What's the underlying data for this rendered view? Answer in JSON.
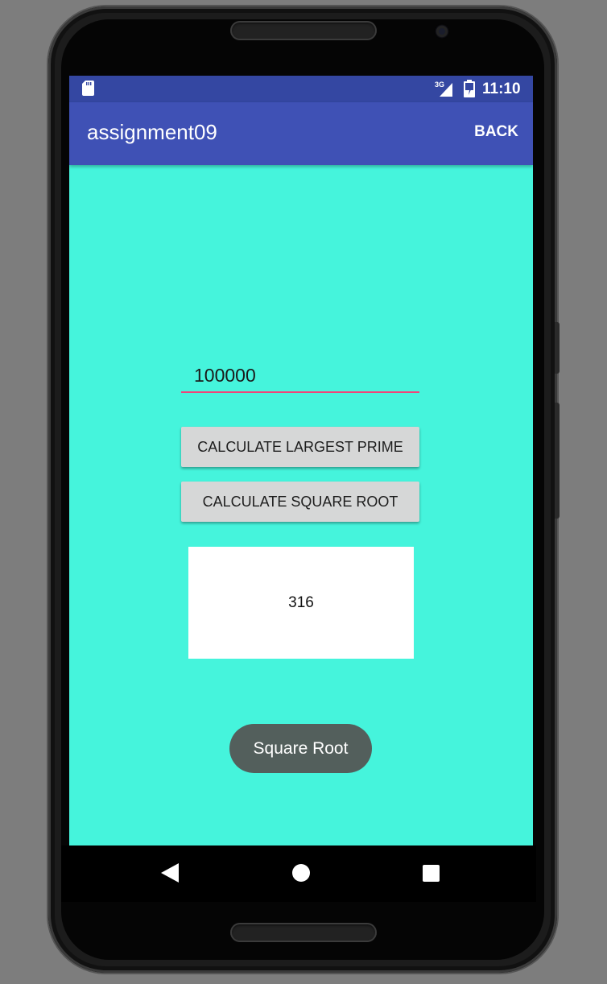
{
  "status_bar": {
    "time": "11:10",
    "network": "3G",
    "icons": [
      "sd-card-icon",
      "signal-3g-icon",
      "battery-charging-icon"
    ]
  },
  "app_bar": {
    "title": "assignment09",
    "back_label": "BACK"
  },
  "main": {
    "number_input_value": "100000",
    "prime_button_label": "CALCULATE LARGEST PRIME",
    "sqrt_button_label": "CALCULATE SQUARE ROOT",
    "result_text": "316",
    "toast_text": "Square Root"
  },
  "colors": {
    "background": "#45f4dc",
    "status_bar": "#3447a2",
    "app_bar": "#3f51b5",
    "input_underline": "#f0457a",
    "button": "#d6d7d7",
    "toast": "#535f5c"
  },
  "nav_bar": {
    "icons": [
      "back-triangle-icon",
      "home-circle-icon",
      "recents-square-icon"
    ]
  }
}
